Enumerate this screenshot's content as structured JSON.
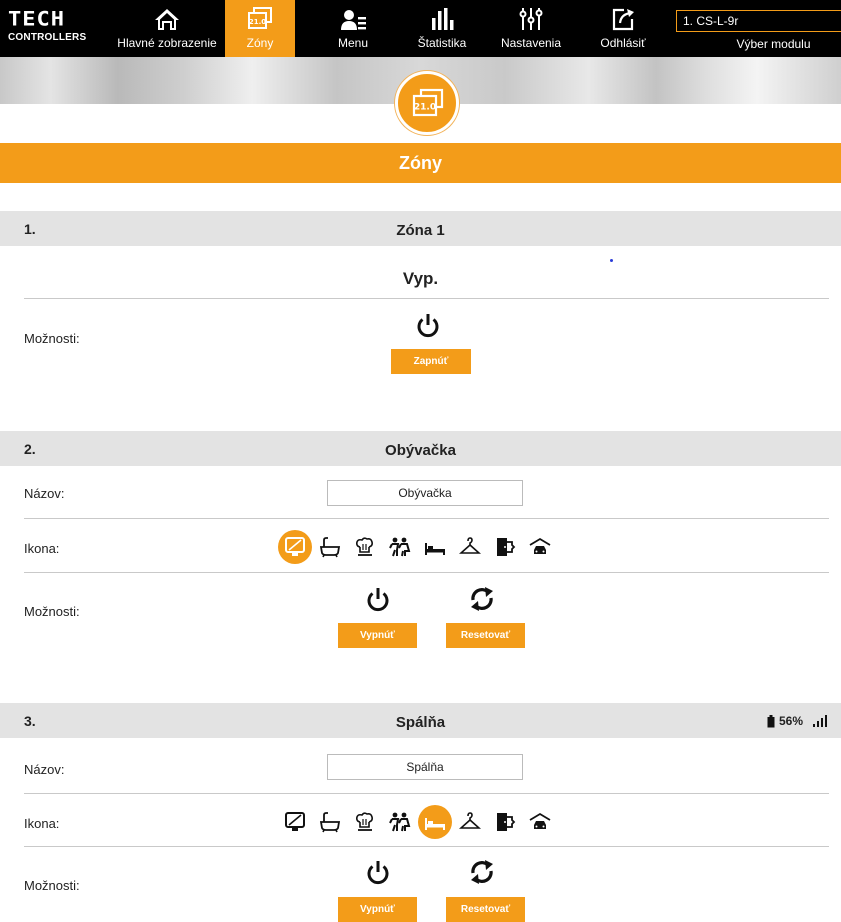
{
  "brand": {
    "line1": "TECH",
    "line2": "CONTROLLERS"
  },
  "nav": [
    {
      "id": "home",
      "label": "Hlavné zobrazenie",
      "icon": "home-icon",
      "active": false
    },
    {
      "id": "zones",
      "label": "Zóny",
      "icon": "zones-icon",
      "active": true
    },
    {
      "id": "menu",
      "label": "Menu",
      "icon": "menu-user-icon",
      "active": false
    },
    {
      "id": "stats",
      "label": "Štatistika",
      "icon": "bar-chart-icon",
      "active": false
    },
    {
      "id": "settings",
      "label": "Nastavenia",
      "icon": "sliders-icon",
      "active": false
    },
    {
      "id": "logout",
      "label": "Odhlásiť",
      "icon": "logout-icon",
      "active": false
    }
  ],
  "module": {
    "selected": "1. CS-L-9r",
    "label": "Výber modulu"
  },
  "badge": {
    "icon": "zones-icon",
    "value": "21.0"
  },
  "page_title": "Zóny",
  "colors": {
    "accent": "#f39c19",
    "header_bg": "#000000",
    "zone_header_bg": "#e3e3e3"
  },
  "zones": [
    {
      "number": "1.",
      "name": "Zóna 1",
      "state": "Vyp.",
      "options_label": "Možnosti:",
      "power_button": "Zapnúť"
    },
    {
      "number": "2.",
      "name": "Obývačka",
      "name_label": "Názov:",
      "name_value": "Obývačka",
      "icon_label": "Ikona:",
      "selected_icon": "tv-icon",
      "options_label": "Možnosti:",
      "power_button": "Vypnúť",
      "reset_button": "Resetovať"
    },
    {
      "number": "3.",
      "name": "Spálňa",
      "battery": "56%",
      "name_label": "Názov:",
      "name_value": "Spálňa",
      "icon_label": "Ikona:",
      "selected_icon": "bed-icon",
      "options_label": "Možnosti:",
      "power_button": "Vypnúť",
      "reset_button": "Resetovať"
    }
  ],
  "icon_set": [
    "tv-icon",
    "bathtub-icon",
    "kitchen-icon",
    "children-icon",
    "bed-icon",
    "hanger-icon",
    "door-icon",
    "garage-icon"
  ]
}
